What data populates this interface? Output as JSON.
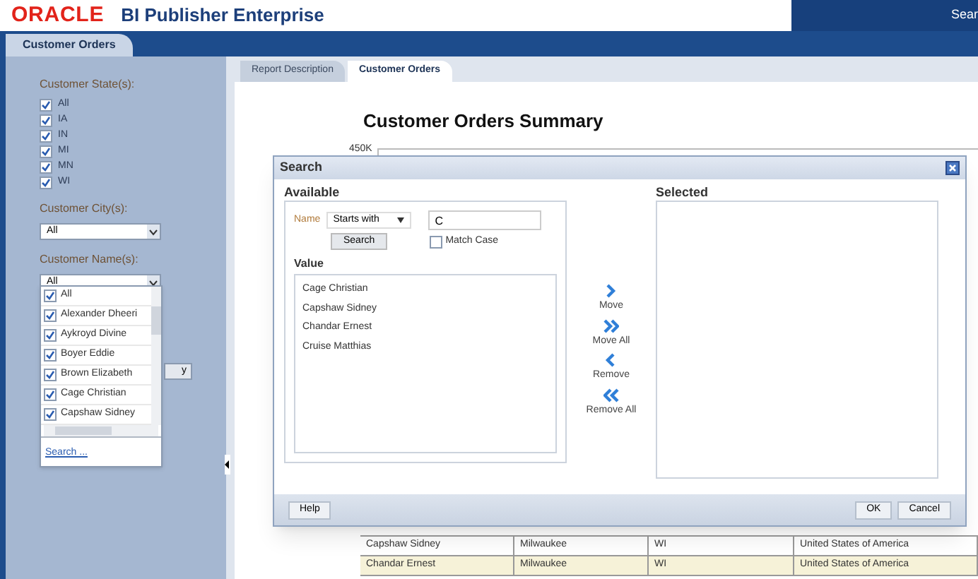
{
  "header": {
    "logo": "ORACLE",
    "product": "BI Publisher Enterprise",
    "search_fragment": "Sear"
  },
  "top_tab": {
    "label": "Customer Orders",
    "selected": true
  },
  "sidebar": {
    "state_label": "Customer State(s):",
    "states": [
      {
        "label": "All",
        "checked": true
      },
      {
        "label": "IA",
        "checked": true
      },
      {
        "label": "IN",
        "checked": true
      },
      {
        "label": "MI",
        "checked": true
      },
      {
        "label": "MN",
        "checked": true
      },
      {
        "label": "WI",
        "checked": true
      }
    ],
    "city_label": "Customer City(s):",
    "city_value": "All",
    "name_label": "Customer Name(s):",
    "name_value": "All",
    "button_fragment": "y",
    "name_options": [
      {
        "label": "All",
        "checked": true
      },
      {
        "label": "Alexander Dheeri",
        "checked": true
      },
      {
        "label": "Aykroyd Divine",
        "checked": true
      },
      {
        "label": "Boyer Eddie",
        "checked": true
      },
      {
        "label": "Brown Elizabeth",
        "checked": true
      },
      {
        "label": "Cage Christian",
        "checked": true
      },
      {
        "label": "Capshaw Sidney",
        "checked": true
      }
    ],
    "search_link": "Search ..."
  },
  "report_tabs": [
    {
      "label": "Report Description",
      "selected": false
    },
    {
      "label": "Customer Orders",
      "selected": true
    }
  ],
  "report": {
    "title": "Customer Orders Summary",
    "chart_tick": "450K",
    "rows": [
      {
        "cells": [
          "Capshaw Sidney",
          "Milwaukee",
          "WI",
          "United States of America"
        ]
      },
      {
        "cells": [
          "Chandar Ernest",
          "Milwaukee",
          "WI",
          "United States of America"
        ]
      }
    ]
  },
  "dialog": {
    "title": "Search",
    "available_label": "Available",
    "name_label": "Name",
    "operator": "Starts with",
    "query": "C",
    "search_button": "Search",
    "match_case": {
      "label": "Match Case",
      "checked": false
    },
    "value_label": "Value",
    "values": [
      "Cage Christian",
      "Capshaw Sidney",
      "Chandar Ernest",
      "Cruise Matthias"
    ],
    "shuttle": [
      {
        "kind": "move",
        "label": "Move"
      },
      {
        "kind": "move_all",
        "label": "Move All"
      },
      {
        "kind": "remove",
        "label": "Remove"
      },
      {
        "kind": "remove_all",
        "label": "Remove All"
      }
    ],
    "selected_label": "Selected",
    "buttons": {
      "help": "Help",
      "ok": "OK",
      "cancel": "Cancel"
    }
  }
}
